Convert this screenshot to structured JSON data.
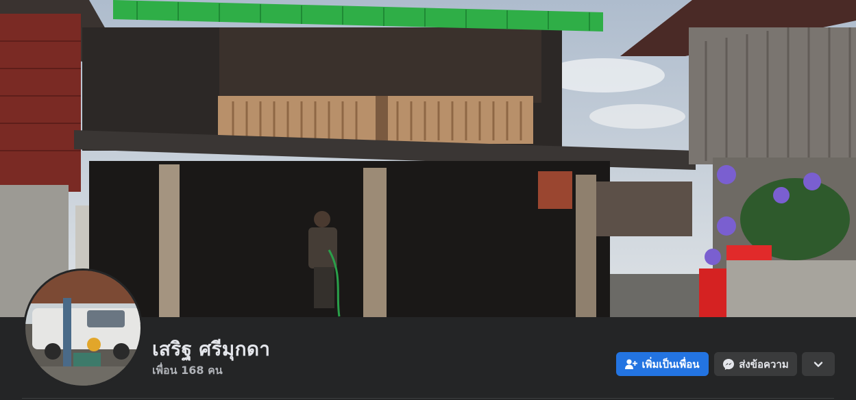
{
  "profile": {
    "name": "เสริฐ ศรีมุกดา",
    "friends_text": "เพื่อน 168 คน"
  },
  "actions": {
    "add_friend_label": "เพิ่มเป็นเพื่อน",
    "message_label": "ส่งข้อความ"
  },
  "icons": {
    "add_friend": "user-plus-icon",
    "message": "messenger-icon",
    "more": "chevron-down-icon"
  },
  "colors": {
    "background": "#242526",
    "primary_button": "#2374e1",
    "secondary_button": "#3a3b3c",
    "name_text": "#e4e6eb",
    "secondary_text": "#b0b3b8"
  }
}
